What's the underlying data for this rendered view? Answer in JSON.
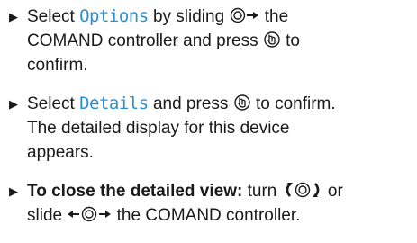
{
  "steps": [
    {
      "lines": [
        {
          "t1": "Select ",
          "term": "Options",
          "t2": " by sliding ",
          "icon_names": [
            "controller-slide-right-icon"
          ],
          "t3": " the"
        },
        {
          "t1": "COMAND controller and press ",
          "icon_names": [
            "press-controller-icon"
          ],
          "t2": " to"
        },
        {
          "t1": "confirm."
        }
      ]
    },
    {
      "lines": [
        {
          "t1": "Select ",
          "term": "Details",
          "t2": " and press ",
          "icon_names": [
            "press-controller-icon"
          ],
          "t3": " to confirm."
        },
        {
          "t1": "The detailed display for this device"
        },
        {
          "t1": "appears."
        }
      ]
    },
    {
      "lines": [
        {
          "bold": "To close the detailed view:",
          "t1": " turn ",
          "icon_names": [
            "controller-turn-icon"
          ],
          "t2": " or"
        },
        {
          "t1": "slide ",
          "icon_names": [
            "controller-slide-left-right-icon"
          ],
          "t2": " the COMAND controller."
        }
      ]
    }
  ],
  "bullet_glyph": "▶",
  "colors": {
    "menu_term": "#2d8fd3",
    "text": "#1a1a1a"
  }
}
